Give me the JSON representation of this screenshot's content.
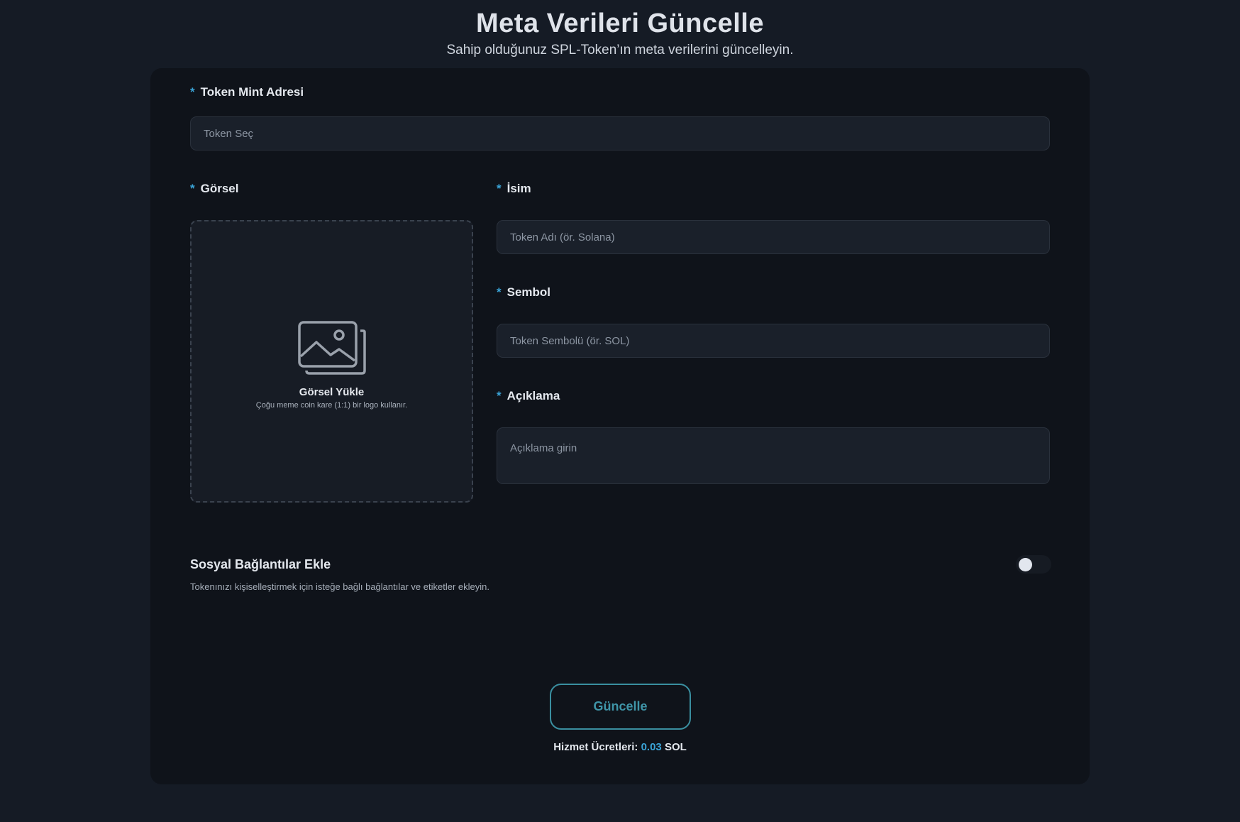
{
  "header": {
    "title": "Meta Verileri Güncelle",
    "subtitle": "Sahip olduğunuz SPL-Token’ın meta verilerini güncelleyin."
  },
  "form": {
    "required_marker": "*",
    "mint": {
      "label": "Token Mint Adresi",
      "placeholder": "Token Seç"
    },
    "image": {
      "label": "Görsel",
      "upload_title": "Görsel Yükle",
      "upload_hint": "Çoğu meme coin kare (1:1) bir logo kullanır.",
      "icon": "image-upload-icon"
    },
    "name": {
      "label": "İsim",
      "placeholder": "Token Adı (ör. Solana)"
    },
    "symbol": {
      "label": "Sembol",
      "placeholder": "Token Sembolü (ör. SOL)"
    },
    "description": {
      "label": "Açıklama",
      "placeholder": "Açıklama girin"
    },
    "social": {
      "title": "Sosyal Bağlantılar Ekle",
      "description": "Tokenınızı kişiselleştirmek için isteğe bağlı bağlantılar ve etiketler ekleyin.",
      "enabled": false
    },
    "submit_label": "Güncelle",
    "fee": {
      "label": "Hizmet Ücretleri:",
      "amount": "0.03",
      "currency": "SOL"
    }
  },
  "colors": {
    "background": "#151b25",
    "card": "#0f131a",
    "accent": "#3aa3d6",
    "button_border": "#3a8fa0"
  }
}
